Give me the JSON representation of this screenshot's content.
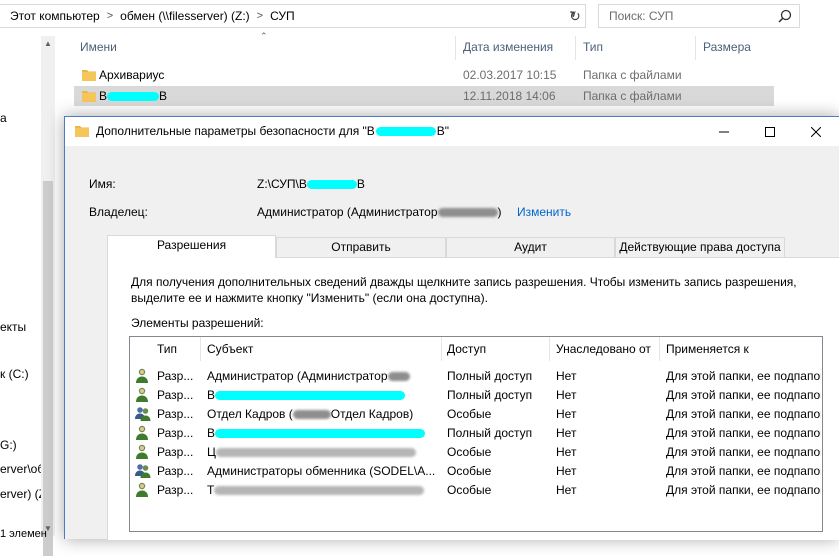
{
  "explorer": {
    "breadcrumb": [
      "Этот компьютер",
      "обмен (\\\\filesserver) (Z:)",
      "СУП"
    ],
    "search_placeholder": "Поиск: СУП",
    "columns": {
      "name": "Имени",
      "date": "Дата изменения",
      "type": "Тип",
      "size": "Размера"
    },
    "files": [
      {
        "name": "Архивариус",
        "date": "02.03.2017 10:15",
        "type": "Папка с файлами"
      },
      {
        "name_prefix": "В",
        "name_suffix": "В",
        "date": "12.11.2018 14:06",
        "type": "Папка с файлами"
      }
    ],
    "nav_fragments": [
      "а",
      "екты",
      "к (C:)",
      "G:)",
      "erver\\об",
      "erver) (Z",
      "1 элемен"
    ],
    "status": "1 элемен"
  },
  "dialog": {
    "title_prefix": "Дополнительные параметры безопасности  для \"В",
    "title_suffix": "В\"",
    "name_label": "Имя:",
    "name_prefix": "Z:\\СУП\\В",
    "name_suffix": "В",
    "owner_label": "Владелец:",
    "owner_value": "Администратор (Администратор",
    "owner_suffix": ")",
    "change_link": "Изменить",
    "tabs": [
      "Разрешения",
      "Отправить",
      "Аудит",
      "Действующие права доступа"
    ],
    "description": "Для получения дополнительных сведений дважды щелкните запись разрешения. Чтобы изменить запись разрешения, выделите ее и нажмите кнопку \"Изменить\" (если она доступна).",
    "elements_label": "Элементы разрешений:",
    "list_headers": [
      "Тип",
      "Субъект",
      "Доступ",
      "Унаследовано от",
      "Применяется к"
    ],
    "rows": [
      {
        "type": "Разр...",
        "subject": "Администратор (Администратор",
        "access": "Полный доступ",
        "inherited": "Нет",
        "applies": "Для этой папки, ее подпапок..."
      },
      {
        "type": "Разр...",
        "subject": "В",
        "access": "Полный доступ",
        "inherited": "Нет",
        "applies": "Для этой папки, ее подпапок..."
      },
      {
        "type": "Разр...",
        "subject": "Отдел Кадров (",
        "subject_suffix": "Отдел Кадров)",
        "access": "Особые",
        "inherited": "Нет",
        "applies": "Для этой папки, ее подпапок..."
      },
      {
        "type": "Разр...",
        "subject": "В",
        "access": "Полный доступ",
        "inherited": "Нет",
        "applies": "Для этой папки, ее подпапок..."
      },
      {
        "type": "Разр...",
        "subject": "Ц",
        "access": "Особые",
        "inherited": "Нет",
        "applies": "Для этой папки, ее подпапок..."
      },
      {
        "type": "Разр...",
        "subject": "Администраторы обменника (SODEL\\А...",
        "access": "Особые",
        "inherited": "Нет",
        "applies": "Для этой папки, ее подпапок..."
      },
      {
        "type": "Разр...",
        "subject": "Т",
        "access": "Особые",
        "inherited": "Нет",
        "applies": "Для этой папки, ее подпапок..."
      }
    ]
  },
  "colors": {
    "accent": "#0066cc",
    "mask": "#00ffff",
    "selection": "#d9d9d9",
    "folder": "#f5c75a"
  }
}
